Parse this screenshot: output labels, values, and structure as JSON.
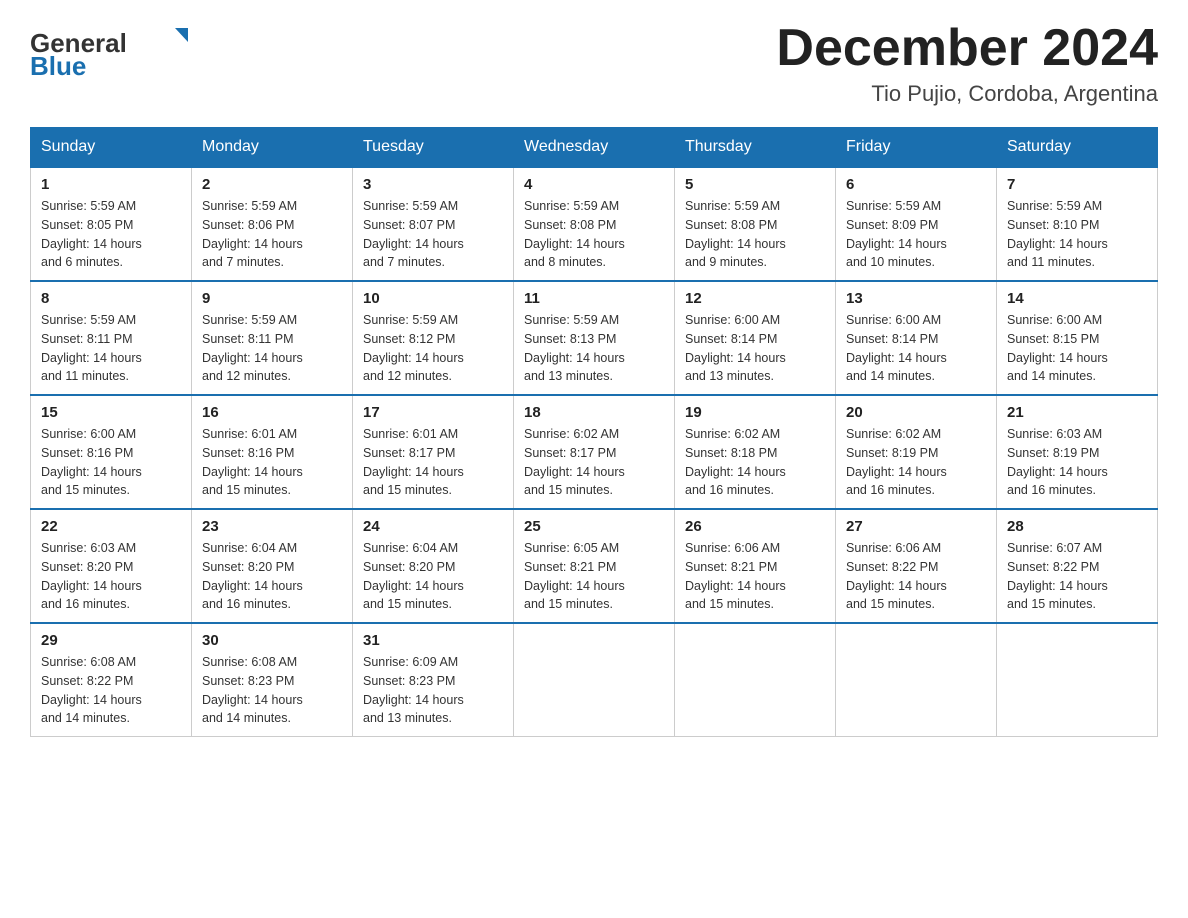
{
  "header": {
    "logo_general": "General",
    "logo_blue": "Blue",
    "month_title": "December 2024",
    "location": "Tio Pujio, Cordoba, Argentina"
  },
  "weekdays": [
    "Sunday",
    "Monday",
    "Tuesday",
    "Wednesday",
    "Thursday",
    "Friday",
    "Saturday"
  ],
  "weeks": [
    [
      {
        "day": "1",
        "sunrise": "5:59 AM",
        "sunset": "8:05 PM",
        "daylight": "14 hours and 6 minutes."
      },
      {
        "day": "2",
        "sunrise": "5:59 AM",
        "sunset": "8:06 PM",
        "daylight": "14 hours and 7 minutes."
      },
      {
        "day": "3",
        "sunrise": "5:59 AM",
        "sunset": "8:07 PM",
        "daylight": "14 hours and 7 minutes."
      },
      {
        "day": "4",
        "sunrise": "5:59 AM",
        "sunset": "8:08 PM",
        "daylight": "14 hours and 8 minutes."
      },
      {
        "day": "5",
        "sunrise": "5:59 AM",
        "sunset": "8:08 PM",
        "daylight": "14 hours and 9 minutes."
      },
      {
        "day": "6",
        "sunrise": "5:59 AM",
        "sunset": "8:09 PM",
        "daylight": "14 hours and 10 minutes."
      },
      {
        "day": "7",
        "sunrise": "5:59 AM",
        "sunset": "8:10 PM",
        "daylight": "14 hours and 11 minutes."
      }
    ],
    [
      {
        "day": "8",
        "sunrise": "5:59 AM",
        "sunset": "8:11 PM",
        "daylight": "14 hours and 11 minutes."
      },
      {
        "day": "9",
        "sunrise": "5:59 AM",
        "sunset": "8:11 PM",
        "daylight": "14 hours and 12 minutes."
      },
      {
        "day": "10",
        "sunrise": "5:59 AM",
        "sunset": "8:12 PM",
        "daylight": "14 hours and 12 minutes."
      },
      {
        "day": "11",
        "sunrise": "5:59 AM",
        "sunset": "8:13 PM",
        "daylight": "14 hours and 13 minutes."
      },
      {
        "day": "12",
        "sunrise": "6:00 AM",
        "sunset": "8:14 PM",
        "daylight": "14 hours and 13 minutes."
      },
      {
        "day": "13",
        "sunrise": "6:00 AM",
        "sunset": "8:14 PM",
        "daylight": "14 hours and 14 minutes."
      },
      {
        "day": "14",
        "sunrise": "6:00 AM",
        "sunset": "8:15 PM",
        "daylight": "14 hours and 14 minutes."
      }
    ],
    [
      {
        "day": "15",
        "sunrise": "6:00 AM",
        "sunset": "8:16 PM",
        "daylight": "14 hours and 15 minutes."
      },
      {
        "day": "16",
        "sunrise": "6:01 AM",
        "sunset": "8:16 PM",
        "daylight": "14 hours and 15 minutes."
      },
      {
        "day": "17",
        "sunrise": "6:01 AM",
        "sunset": "8:17 PM",
        "daylight": "14 hours and 15 minutes."
      },
      {
        "day": "18",
        "sunrise": "6:02 AM",
        "sunset": "8:17 PM",
        "daylight": "14 hours and 15 minutes."
      },
      {
        "day": "19",
        "sunrise": "6:02 AM",
        "sunset": "8:18 PM",
        "daylight": "14 hours and 16 minutes."
      },
      {
        "day": "20",
        "sunrise": "6:02 AM",
        "sunset": "8:19 PM",
        "daylight": "14 hours and 16 minutes."
      },
      {
        "day": "21",
        "sunrise": "6:03 AM",
        "sunset": "8:19 PM",
        "daylight": "14 hours and 16 minutes."
      }
    ],
    [
      {
        "day": "22",
        "sunrise": "6:03 AM",
        "sunset": "8:20 PM",
        "daylight": "14 hours and 16 minutes."
      },
      {
        "day": "23",
        "sunrise": "6:04 AM",
        "sunset": "8:20 PM",
        "daylight": "14 hours and 16 minutes."
      },
      {
        "day": "24",
        "sunrise": "6:04 AM",
        "sunset": "8:20 PM",
        "daylight": "14 hours and 15 minutes."
      },
      {
        "day": "25",
        "sunrise": "6:05 AM",
        "sunset": "8:21 PM",
        "daylight": "14 hours and 15 minutes."
      },
      {
        "day": "26",
        "sunrise": "6:06 AM",
        "sunset": "8:21 PM",
        "daylight": "14 hours and 15 minutes."
      },
      {
        "day": "27",
        "sunrise": "6:06 AM",
        "sunset": "8:22 PM",
        "daylight": "14 hours and 15 minutes."
      },
      {
        "day": "28",
        "sunrise": "6:07 AM",
        "sunset": "8:22 PM",
        "daylight": "14 hours and 15 minutes."
      }
    ],
    [
      {
        "day": "29",
        "sunrise": "6:08 AM",
        "sunset": "8:22 PM",
        "daylight": "14 hours and 14 minutes."
      },
      {
        "day": "30",
        "sunrise": "6:08 AM",
        "sunset": "8:23 PM",
        "daylight": "14 hours and 14 minutes."
      },
      {
        "day": "31",
        "sunrise": "6:09 AM",
        "sunset": "8:23 PM",
        "daylight": "14 hours and 13 minutes."
      },
      null,
      null,
      null,
      null
    ]
  ],
  "labels": {
    "sunrise": "Sunrise:",
    "sunset": "Sunset:",
    "daylight": "Daylight:"
  }
}
